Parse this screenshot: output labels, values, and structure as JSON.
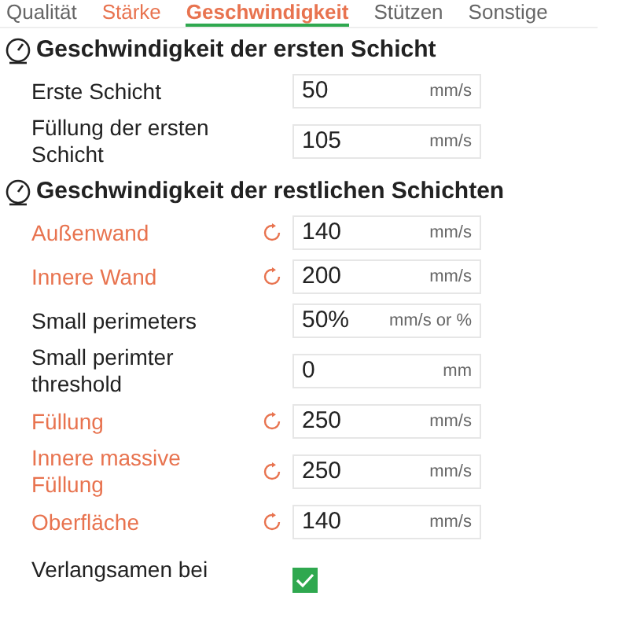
{
  "tabs": [
    {
      "label": "Qualität",
      "selected": false,
      "modified": false
    },
    {
      "label": "Stärke",
      "selected": false,
      "modified": true
    },
    {
      "label": "Geschwindigkeit",
      "selected": true,
      "modified": true
    },
    {
      "label": "Stützen",
      "selected": false,
      "modified": false
    },
    {
      "label": "Sonstige",
      "selected": false,
      "modified": false
    }
  ],
  "sections": [
    {
      "title": "Geschwindigkeit der ersten Schicht",
      "rows": [
        {
          "kind": "field",
          "label": "Erste Schicht",
          "modified": false,
          "value": "50",
          "unit": "mm/s"
        },
        {
          "kind": "field",
          "label": "Füllung der ersten Schicht",
          "modified": false,
          "value": "105",
          "unit": "mm/s"
        }
      ]
    },
    {
      "title": "Geschwindigkeit der restlichen Schichten",
      "rows": [
        {
          "kind": "field",
          "label": "Außenwand",
          "modified": true,
          "value": "140",
          "unit": "mm/s"
        },
        {
          "kind": "field",
          "label": "Innere Wand",
          "modified": true,
          "value": "200",
          "unit": "mm/s"
        },
        {
          "kind": "field",
          "label": "Small perimeters",
          "modified": false,
          "value": "50%",
          "unit": "mm/s or %"
        },
        {
          "kind": "field",
          "label": "Small perimter threshold",
          "modified": false,
          "value": "0",
          "unit": "mm"
        },
        {
          "kind": "field",
          "label": "Füllung",
          "modified": true,
          "value": "250",
          "unit": "mm/s"
        },
        {
          "kind": "field",
          "label": "Innere massive Füllung",
          "modified": true,
          "value": "250",
          "unit": "mm/s"
        },
        {
          "kind": "field",
          "label": "Oberfläche",
          "modified": true,
          "value": "140",
          "unit": "mm/s"
        },
        {
          "kind": "checkbox",
          "label": "Verlangsamen bei",
          "modified": false,
          "checked": true
        }
      ]
    }
  ]
}
